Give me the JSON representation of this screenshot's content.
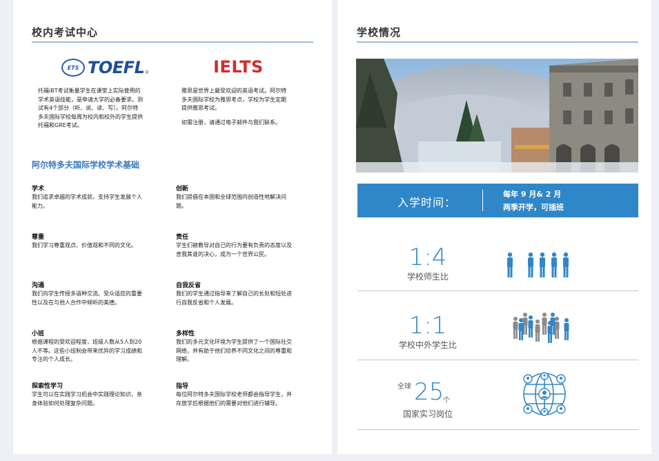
{
  "left": {
    "title": "校内考试中心",
    "toefl": {
      "badge": "ETS",
      "word": "TOEFL",
      "mark": "®",
      "text": [
        "托福iBT考试衡量学生在课堂上实际使用的",
        "学术英语技能，是申请大学的必备要求。测",
        "试有4个部分（听、说、读、写）。阿尔特",
        "多夫国际学校每周为校内和校外的学生提供",
        "托福和GRE考试。"
      ]
    },
    "ielts": {
      "word": "IELTS",
      "text": [
        "雅思是世界上最受欢迎的英语考试。阿尔特",
        "多夫国际学校为雅思考点，学校为学生定期",
        "提供雅思考试。"
      ],
      "note": "如需注册，请通过电子邮件与我们联系。"
    },
    "subhead": "阿尔特多夫国际学校学术基础",
    "items": [
      {
        "title": "学术",
        "desc": [
          "我们追求卓越的学术成就，支持学生发展个人",
          "能力。"
        ]
      },
      {
        "title": "创新",
        "desc": [
          "我们提倡在本国和全球范围内创造性地解决问",
          "题。"
        ]
      },
      {
        "title": "尊重",
        "desc": [
          "我们学习尊重观点、价值观和不同的文化。"
        ]
      },
      {
        "title": "责任",
        "desc": [
          "学生们被教导对自己的行为要有负责的态度以及",
          "舍我其谁的决心，成为一个世界公民。"
        ]
      },
      {
        "title": "沟通",
        "desc": [
          "我们向学生传授多语种交流、受众适应的重要",
          "性以及在与他人合作中倾听的美德。"
        ]
      },
      {
        "title": "自我反省",
        "desc": [
          "我们的学生通过指导来了解自己的长处和短处进",
          "行自我反省和个人发展。"
        ]
      },
      {
        "title": "小班",
        "desc": [
          "根据课程的受欢迎程度，班级人数从5人到20",
          "人不等。这些小班制会带来优异的学习成绩和",
          "专注的个人成长。"
        ]
      },
      {
        "title": "多样性",
        "desc": [
          "我们的多元文化环境为学生提供了一个国际社交",
          "网络，并有助于他们培养不同文化之间的尊重和",
          "理解。"
        ]
      },
      {
        "title": "探索性学习",
        "desc": [
          "学生可以在实践学习机会中实践理论知识，亲",
          "身体验如何处理复杂问题。"
        ]
      },
      {
        "title": "指导",
        "desc": [
          "每位阿尔特多夫国际学校老师都会指导学生，并",
          "存放学后根据他们的需要对他们进行辅导。"
        ]
      }
    ]
  },
  "right": {
    "title": "学校情况",
    "banner": {
      "label": "入学时间：",
      "line1": "每年 9 月& 2 月",
      "line2": "两季开学，可插班"
    },
    "stats": [
      {
        "value": "1:4",
        "label": "学校师生比",
        "icon": "teacher-students-icon"
      },
      {
        "value": "1:1",
        "label": "学校中外学生比",
        "icon": "crowd-icon"
      },
      {
        "prefix": "全球",
        "value": "25",
        "suffix": "个",
        "label": "国家实习岗位",
        "icon": "globe-network-icon"
      }
    ]
  },
  "colors": {
    "accent": "#2f86c8",
    "rule": "#9fb9d9",
    "ielts": "#d62a2a",
    "toefl": "#1d4e9a",
    "grey_person": "#8a8a8a"
  }
}
